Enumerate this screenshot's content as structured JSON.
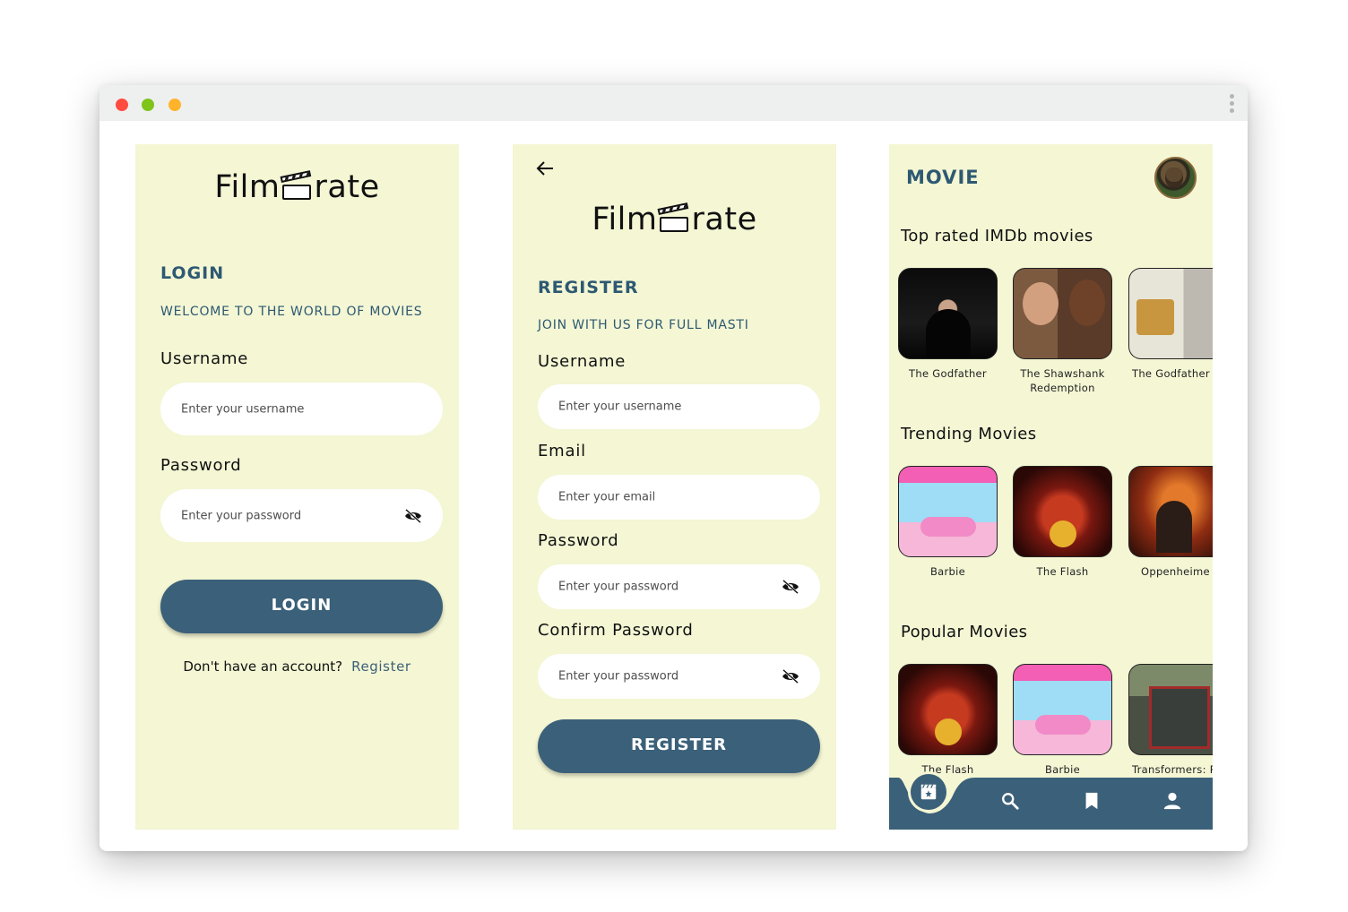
{
  "app": {
    "brand_left": "Film",
    "brand_right": "rate"
  },
  "login": {
    "heading": "LOGIN",
    "subheading": "WELCOME TO THE WORLD OF MOVIES",
    "username_label": "Username",
    "username_placeholder": "Enter your username",
    "password_label": "Password",
    "password_placeholder": "Enter your password",
    "button": "LOGIN",
    "no_account": "Don't have an account?",
    "register_link": "Register"
  },
  "register": {
    "heading": "REGISTER",
    "subheading": "JOIN WITH US FOR FULL MASTI",
    "username_label": "Username",
    "username_placeholder": "Enter your username",
    "email_label": "Email",
    "email_placeholder": "Enter your email",
    "password_label": "Password",
    "password_placeholder": "Enter your password",
    "confirm_label": "Confirm Password",
    "confirm_placeholder": "Enter your password",
    "button": "REGISTER"
  },
  "home": {
    "title": "MOVIE",
    "sections": [
      {
        "title": "Top rated IMDb movies",
        "movies": [
          "The Godfather",
          "The Shawshank Redemption",
          "The Godfather P"
        ]
      },
      {
        "title": "Trending Movies",
        "movies": [
          "Barbie",
          "The Flash",
          "Oppenheime"
        ]
      },
      {
        "title": "Popular Movies",
        "movies": [
          "The Flash",
          "Barbie",
          "Transformers: Ri"
        ]
      }
    ],
    "nav": [
      "movies-icon",
      "search-icon",
      "bookmark-icon",
      "profile-icon"
    ],
    "accent": "#3b6079",
    "panel_bg": "#f4f6d4"
  }
}
